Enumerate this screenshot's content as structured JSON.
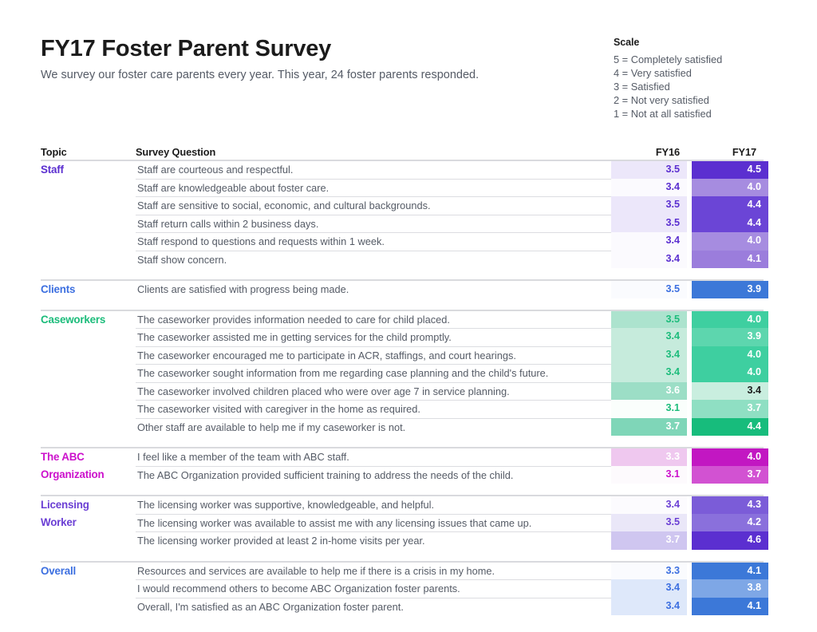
{
  "header": {
    "title": "FY17 Foster Parent Survey",
    "subtitle": "We survey our foster care parents every year. This year, 24 foster parents responded."
  },
  "scale": {
    "title": "Scale",
    "lines": [
      "5 = Completely satisfied",
      "4 = Very satisfied",
      "3 = Satisfied",
      "2 = Not very satisfied",
      "1 = Not at all satisfied"
    ]
  },
  "table": {
    "columns": {
      "topic": "Topic",
      "question": "Survey Question",
      "fy16": "FY16",
      "fy17": "FY17"
    }
  },
  "colors": {
    "staff": "#5B2FD0",
    "clients": "#3C6FE0",
    "caseworkers": "#1CBC7B",
    "abc": "#CC11CC",
    "licensing": "#6B3FD4",
    "overall": "#3C6FE0"
  },
  "sections": [
    {
      "topic": "Staff",
      "topic_lines": [
        "Staff"
      ],
      "accent": "#5B2FD0",
      "rows": [
        {
          "question": "Staff are courteous and respectful.",
          "fy16": "3.5",
          "fy17": "4.5",
          "fy16_bg": "#ECE7FA",
          "fy17_bg": "#5B2FD0",
          "fy16_fg": "#5B2FD0",
          "fy17_fg": "#FFFFFF"
        },
        {
          "question": "Staff are knowledgeable about foster care.",
          "fy16": "3.4",
          "fy17": "4.0",
          "fy16_bg": "#FBFAFE",
          "fy17_bg": "#A68CE0",
          "fy16_fg": "#5B2FD0",
          "fy17_fg": "#FFFFFF"
        },
        {
          "question": "Staff are sensitive to social, economic, and cultural backgrounds.",
          "fy16": "3.5",
          "fy17": "4.4",
          "fy16_bg": "#ECE7FA",
          "fy17_bg": "#6B45D6",
          "fy16_fg": "#5B2FD0",
          "fy17_fg": "#FFFFFF"
        },
        {
          "question": "Staff return calls within 2 business days.",
          "fy16": "3.5",
          "fy17": "4.4",
          "fy16_bg": "#ECE7FA",
          "fy17_bg": "#6B45D6",
          "fy16_fg": "#5B2FD0",
          "fy17_fg": "#FFFFFF"
        },
        {
          "question": "Staff respond to questions and requests within 1 week.",
          "fy16": "3.4",
          "fy17": "4.0",
          "fy16_bg": "#FBFAFE",
          "fy17_bg": "#A68CE0",
          "fy16_fg": "#5B2FD0",
          "fy17_fg": "#FFFFFF"
        },
        {
          "question": "Staff show concern.",
          "fy16": "3.4",
          "fy17": "4.1",
          "fy16_bg": "#FBFAFE",
          "fy17_bg": "#9B7DDC",
          "fy16_fg": "#5B2FD0",
          "fy17_fg": "#FFFFFF"
        }
      ]
    },
    {
      "topic": "Clients",
      "topic_lines": [
        "Clients"
      ],
      "accent": "#3C6FE0",
      "rows": [
        {
          "question": "Clients are satisfied with progress being made.",
          "fy16": "3.5",
          "fy17": "3.9",
          "fy16_bg": "#FAFBFE",
          "fy17_bg": "#3C78D8",
          "fy16_fg": "#3C6FE0",
          "fy17_fg": "#FFFFFF"
        }
      ]
    },
    {
      "topic": "Caseworkers",
      "topic_lines": [
        "Caseworkers"
      ],
      "accent": "#1CBC7B",
      "rows": [
        {
          "question": "The caseworker provides information needed to care for child placed.",
          "fy16": "3.5",
          "fy17": "4.0",
          "fy16_bg": "#ACE3CE",
          "fy17_bg": "#3ECFA0",
          "fy16_fg": "#1CBC7B",
          "fy17_fg": "#FFFFFF"
        },
        {
          "question": "The caseworker assisted me in getting services for the child promptly.",
          "fy16": "3.4",
          "fy17": "3.9",
          "fy16_bg": "#C6EBDC",
          "fy17_bg": "#5DD6AE",
          "fy16_fg": "#1CBC7B",
          "fy17_fg": "#FFFFFF"
        },
        {
          "question": "The caseworker encouraged me to participate in ACR, staffings, and court hearings.",
          "fy16": "3.4",
          "fy17": "4.0",
          "fy16_bg": "#C6EBDC",
          "fy17_bg": "#3ECFA0",
          "fy16_fg": "#1CBC7B",
          "fy17_fg": "#FFFFFF"
        },
        {
          "question": "The caseworker sought information from me regarding case planning and the child's future.",
          "fy16": "3.4",
          "fy17": "4.0",
          "fy16_bg": "#C6EBDC",
          "fy17_bg": "#3ECFA0",
          "fy16_fg": "#1CBC7B",
          "fy17_fg": "#FFFFFF"
        },
        {
          "question": "The caseworker involved children placed who were over age 7 in service planning.",
          "fy16": "3.6",
          "fy17": "3.4",
          "fy16_bg": "#9CDEC6",
          "fy17_bg": "#C9EEDF",
          "fy16_fg": "#FFFFFF",
          "fy17_fg": "#1B1B1B"
        },
        {
          "question": "The caseworker visited with caregiver in the home as required.",
          "fy16": "3.1",
          "fy17": "3.7",
          "fy16_bg": "#FAFEFC",
          "fy17_bg": "#8FDFC3",
          "fy16_fg": "#1CBC7B",
          "fy17_fg": "#FFFFFF"
        },
        {
          "question": "Other staff are available to help me if my caseworker is not.",
          "fy16": "3.7",
          "fy17": "4.4",
          "fy16_bg": "#7FD6B8",
          "fy17_bg": "#17BC7C",
          "fy16_fg": "#FFFFFF",
          "fy17_fg": "#FFFFFF"
        }
      ]
    },
    {
      "topic": "The ABC Organization",
      "topic_lines": [
        "The ABC",
        "Organization"
      ],
      "accent": "#CC11CC",
      "rows": [
        {
          "question": "I feel like a member of the team with ABC staff.",
          "fy16": "3.3",
          "fy17": "4.0",
          "fy16_bg": "#EFC8EF",
          "fy17_bg": "#C217C2",
          "fy16_fg": "#FFFFFF",
          "fy17_fg": "#FFFFFF"
        },
        {
          "question": "The ABC Organization provided sufficient training to address the needs of the child.",
          "fy16": "3.1",
          "fy17": "3.7",
          "fy16_bg": "#FDFAFD",
          "fy17_bg": "#D252D2",
          "fy16_fg": "#CC11CC",
          "fy17_fg": "#FFFFFF"
        }
      ]
    },
    {
      "topic": "Licensing Worker",
      "topic_lines": [
        "Licensing",
        "Worker"
      ],
      "accent": "#6B3FD4",
      "rows": [
        {
          "question": "The licensing worker was supportive, knowledgeable, and helpful.",
          "fy16": "3.4",
          "fy17": "4.3",
          "fy16_bg": "#FCFBFE",
          "fy17_bg": "#7B5CD8",
          "fy16_fg": "#6B3FD4",
          "fy17_fg": "#FFFFFF"
        },
        {
          "question": "The licensing worker was available to assist me with any licensing issues that came up.",
          "fy16": "3.5",
          "fy17": "4.2",
          "fy16_bg": "#EAE7F8",
          "fy17_bg": "#8A70DC",
          "fy16_fg": "#6B3FD4",
          "fy17_fg": "#FFFFFF"
        },
        {
          "question": "The licensing worker provided at least 2 in-home visits per year.",
          "fy16": "3.7",
          "fy17": "4.6",
          "fy16_bg": "#CFC6F0",
          "fy17_bg": "#5B2FD0",
          "fy16_fg": "#FFFFFF",
          "fy17_fg": "#FFFFFF"
        }
      ]
    },
    {
      "topic": "Overall",
      "topic_lines": [
        "Overall"
      ],
      "accent": "#3C6FE0",
      "rows": [
        {
          "question": "Resources and services are available to help me if there is a crisis in my home.",
          "fy16": "3.3",
          "fy17": "4.1",
          "fy16_bg": "#FAFBFE",
          "fy17_bg": "#3C78D8",
          "fy16_fg": "#3C6FE0",
          "fy17_fg": "#FFFFFF"
        },
        {
          "question": "I would recommend others to become ABC Organization foster parents.",
          "fy16": "3.4",
          "fy17": "3.8",
          "fy16_bg": "#DEE8FA",
          "fy17_bg": "#7EA7E6",
          "fy16_fg": "#3C6FE0",
          "fy17_fg": "#FFFFFF"
        },
        {
          "question": "Overall, I'm satisfied as an ABC Organization foster parent.",
          "fy16": "3.4",
          "fy17": "4.1",
          "fy16_bg": "#DEE8FA",
          "fy17_bg": "#3C78D8",
          "fy16_fg": "#3C6FE0",
          "fy17_fg": "#FFFFFF"
        }
      ]
    }
  ]
}
